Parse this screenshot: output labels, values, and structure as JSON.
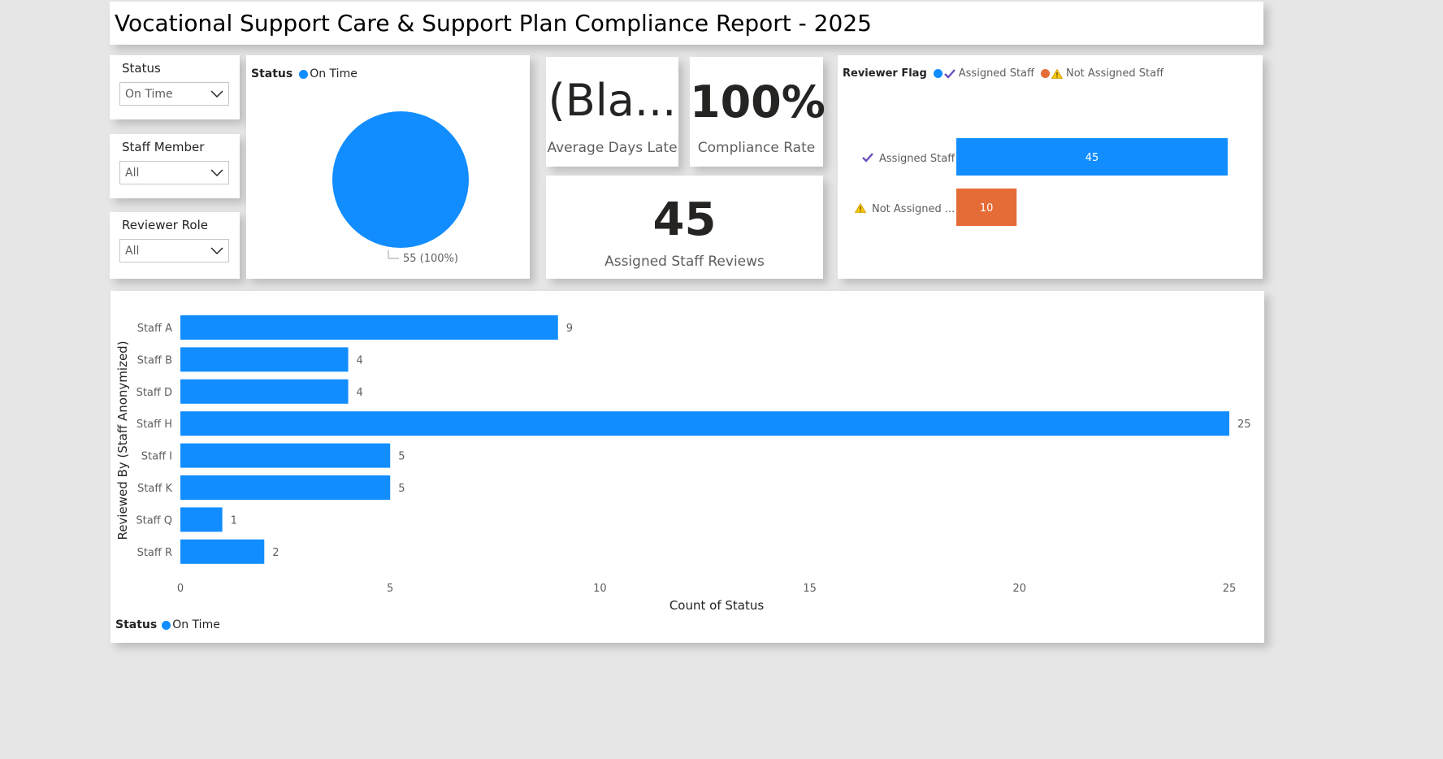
{
  "header": {
    "title": "Vocational Support Care & Support Plan Compliance Report - 2025"
  },
  "slicers": [
    {
      "title": "Status",
      "value": "On Time"
    },
    {
      "title": "Staff Member",
      "value": "All"
    },
    {
      "title": "Reviewer Role",
      "value": "All"
    }
  ],
  "pie": {
    "legend_title": "Status",
    "legend_item": "On Time",
    "slice_label": "55 (100%)"
  },
  "kpis": {
    "avg_days_late": {
      "value": "(Bla...",
      "label": "Average Days Late"
    },
    "compliance_rate": {
      "value": "100%",
      "label": "Compliance Rate"
    },
    "assigned_reviews": {
      "value": "45",
      "label": "Assigned Staff Reviews"
    }
  },
  "reviewer_flag": {
    "legend_title": "Reviewer Flag",
    "legend_items": [
      "Assigned Staff",
      "Not Assigned Staff"
    ],
    "row_labels": [
      "Assigned Staff",
      "Not Assigned ..."
    ]
  },
  "staff_chart": {
    "legend_title": "Status",
    "legend_item": "On Time"
  },
  "colors": {
    "blue": "#118dff",
    "orange": "#e66c37",
    "check": "#6b4fbb",
    "warn": "#f2c811"
  },
  "chart_data": [
    {
      "type": "pie",
      "categories": [
        "On Time"
      ],
      "values": [
        55
      ]
    },
    {
      "type": "bar",
      "orientation": "horizontal",
      "categories": [
        "Assigned Staff",
        "Not Assigned Staff"
      ],
      "values": [
        45,
        10
      ],
      "xlim": [
        0,
        45
      ]
    },
    {
      "type": "bar",
      "orientation": "horizontal",
      "categories": [
        "Staff A",
        "Staff B",
        "Staff D",
        "Staff H",
        "Staff I",
        "Staff K",
        "Staff Q",
        "Staff R"
      ],
      "values": [
        9,
        4,
        4,
        25,
        5,
        5,
        1,
        2
      ],
      "xlabel": "Count of Status",
      "ylabel": "Reviewed By (Staff Anonymized)",
      "xlim": [
        0,
        25
      ],
      "xticks": [
        0,
        5,
        10,
        15,
        20,
        25
      ],
      "grid": false
    }
  ]
}
